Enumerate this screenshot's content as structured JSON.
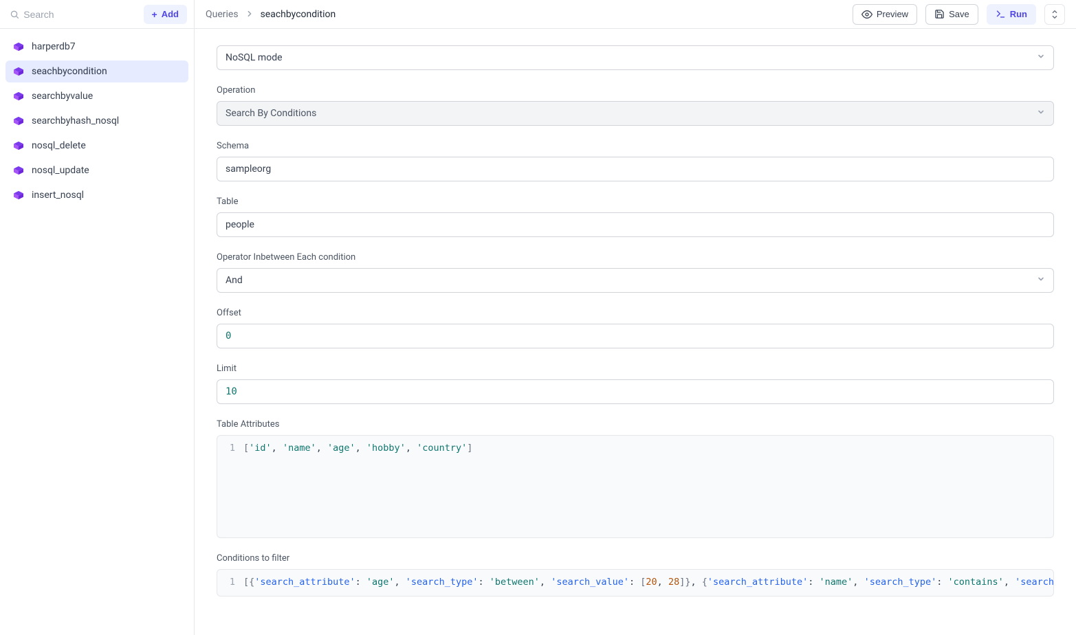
{
  "sidebar": {
    "search_placeholder": "Search",
    "add_label": "Add",
    "items": [
      {
        "label": "harperdb7",
        "active": false
      },
      {
        "label": "seachbycondition",
        "active": true
      },
      {
        "label": "searchbyvalue",
        "active": false
      },
      {
        "label": "searchbyhash_nosql",
        "active": false
      },
      {
        "label": "nosql_delete",
        "active": false
      },
      {
        "label": "nosql_update",
        "active": false
      },
      {
        "label": "insert_nosql",
        "active": false
      }
    ]
  },
  "breadcrumbs": {
    "root": "Queries",
    "current": "seachbycondition"
  },
  "topbar": {
    "preview_label": "Preview",
    "save_label": "Save",
    "run_label": "Run"
  },
  "form": {
    "mode_label": "NoSQL mode",
    "operation": {
      "label": "Operation",
      "value": "Search By Conditions"
    },
    "schema": {
      "label": "Schema",
      "value": "sampleorg"
    },
    "table": {
      "label": "Table",
      "value": "people"
    },
    "operator": {
      "label": "Operator Inbetween Each condition",
      "value": "And"
    },
    "offset": {
      "label": "Offset",
      "value": "0"
    },
    "limit": {
      "label": "Limit",
      "value": "10"
    },
    "table_attributes": {
      "label": "Table Attributes",
      "line_no": "1",
      "tokens": "['id', 'name', 'age', 'hobby', 'country']"
    },
    "conditions": {
      "label": "Conditions to filter",
      "line_no": "1",
      "tokens": "[{'search_attribute': 'age', 'search_type': 'between', 'search_value': [20, 28]}, {'search_attribute': 'name', 'search_type': 'contains', 'search_value': 'Ray'}]"
    }
  }
}
